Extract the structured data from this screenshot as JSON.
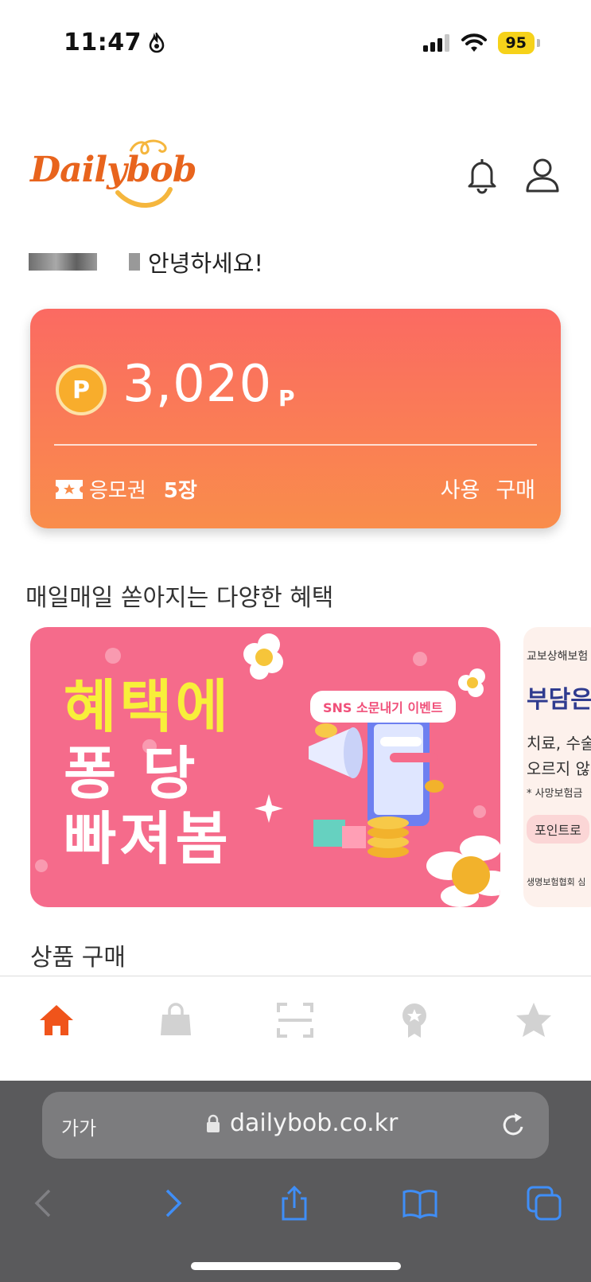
{
  "status_bar": {
    "time": "11:47",
    "battery": "95"
  },
  "header": {
    "logo_text": "Dailybob",
    "icons": [
      "bell-icon",
      "user-icon"
    ]
  },
  "greeting": {
    "text": "안녕하세요!"
  },
  "point_card": {
    "points": "3,020",
    "unit": "P",
    "coin_label": "P",
    "ticket_label": "응모권",
    "ticket_count": "5장",
    "actions": [
      "사용",
      "구매"
    ]
  },
  "benefits": {
    "title": "매일매일 쏟아지는 다양한 혜택",
    "banner1": {
      "lines": [
        "혜택에",
        "퐁 당",
        "빠져봄"
      ],
      "pill": "SNS 소문내기 이벤트"
    },
    "banner2": {
      "lines": [
        "교보상해보험",
        "부담은",
        "치료, 수술",
        "오르지 않",
        "* 사망보험금",
        "포인트로",
        "생명보험협회 심"
      ]
    }
  },
  "products": {
    "title": "상품 구매"
  },
  "tabbar": {
    "tabs": [
      "home-icon",
      "shopping-bag-icon",
      "scan-icon",
      "badge-icon",
      "star-icon"
    ],
    "active_index": 0
  },
  "browser": {
    "aa_label": "가가",
    "url": "dailybob.co.kr"
  },
  "colors": {
    "brand": "#e8641d",
    "card_top": "#fb6a62",
    "card_bottom": "#f98d4b",
    "banner_pink": "#f56b8b",
    "active_tab": "#f0541b",
    "inactive_tab": "#d2d2d2",
    "safari_blue": "#3f8ef7"
  }
}
